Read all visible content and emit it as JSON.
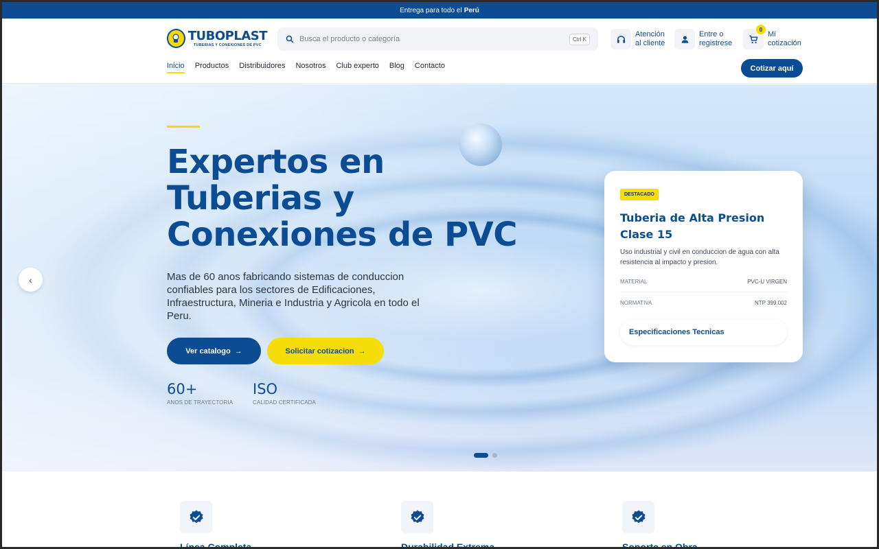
{
  "topbar": {
    "text": "Entrega para todo el",
    "highlight": "Perú"
  },
  "header": {
    "logo": {
      "name": "TUBOPLAST",
      "tagline": "TUBERIAS Y CONEXIONES DE PVC"
    },
    "search": {
      "placeholder": "Busca el producto o categoría",
      "shortcut": "Ctrl K"
    },
    "support": {
      "line1": "Atención",
      "line2": "al cliente",
      "icon": "headset-icon"
    },
    "account": {
      "line1": "Entre o",
      "line2": "registrese",
      "icon": "user-icon"
    },
    "cart": {
      "line1": "Mi",
      "line2": "cotización",
      "count": "0",
      "icon": "cart-icon"
    },
    "nav": [
      "Inicio",
      "Productos",
      "Distribuidores",
      "Nosotros",
      "Club experto",
      "Blog",
      "Contacto"
    ],
    "cta": "Cotizar aquí"
  },
  "hero": {
    "title_lines": [
      "Expertos en",
      "Tuberias y",
      "Conexiones de PVC"
    ],
    "description": "Mas de 60 anos fabricando sistemas de conduccion confiables para los sectores de Edificaciones, Infraestructura, Mineria e Industria y Agricola en todo el Peru.",
    "primary_button": "Ver catalogo",
    "secondary_button": "Solicitar cotizacion",
    "stats": [
      {
        "value": "60+",
        "label": "ANOS DE TRAYECTORIA"
      },
      {
        "value": "ISO",
        "label": "CALIDAD CERTIFICADA"
      }
    ],
    "slides": {
      "current": 1,
      "total": 2
    }
  },
  "featured_card": {
    "badge": "DESTACADO",
    "title": "Tuberia de Alta Presion Clase 15",
    "description": "Uso industrial y civil en conduccion de agua con alta resistencia al impacto y presion.",
    "specs": [
      {
        "label": "MATERIAL",
        "value": "PVC-U VIRGEN"
      },
      {
        "label": "NORMATIVA",
        "value": "NTP 399.002"
      }
    ],
    "button": "Especificaciones Tecnicas"
  },
  "features": [
    {
      "title": "Línea Completa",
      "icon": "verified-badge-icon"
    },
    {
      "title": "Durabilidad Extrema",
      "icon": "verified-badge-icon"
    },
    {
      "title": "Soporte en Obra",
      "icon": "verified-badge-icon"
    }
  ],
  "colors": {
    "primary": "#0b4c92",
    "accent": "#f5dd0a",
    "topbar": "#0b4c92"
  }
}
